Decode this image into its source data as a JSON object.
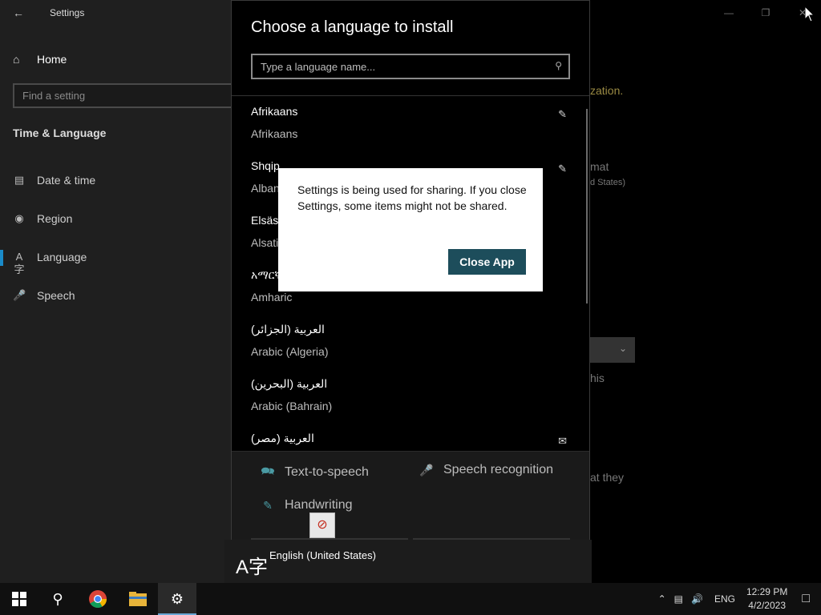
{
  "settings": {
    "app_title": "Settings",
    "home_label": "Home",
    "find_placeholder": "Find a setting",
    "section_title": "Time & Language",
    "nav": [
      {
        "label": "Date & time",
        "icon": "calendar-clock-icon"
      },
      {
        "label": "Region",
        "icon": "globe-icon"
      },
      {
        "label": "Language",
        "icon": "language-icon"
      },
      {
        "label": "Speech",
        "icon": "microphone-icon"
      }
    ],
    "accent_color": "#1a8bc9"
  },
  "background_snippets": {
    "s1": "zation.",
    "s2": "mat",
    "s3": "d States)",
    "s4": "his",
    "s5": "at they"
  },
  "dialog": {
    "title": "Choose a language to install",
    "search_placeholder": "Type a language name...",
    "languages": [
      {
        "native": "Afrikaans",
        "english": "Afrikaans",
        "feature_icon": "handwriting-icon"
      },
      {
        "native": "Shqip",
        "english": "Alban",
        "feature_icon": "handwriting-icon"
      },
      {
        "native": "Elsäss",
        "english": "Alsati"
      },
      {
        "native": "አማርኛ",
        "english": "Amharic"
      },
      {
        "native": "العربية (الجزائر)",
        "english": "Arabic (Algeria)"
      },
      {
        "native": "العربية (البحرين)",
        "english": "Arabic (Bahrain)"
      },
      {
        "native": "العربية (مصر)",
        "english": "",
        "feature_icon": "display-language-icon"
      }
    ],
    "features": {
      "tts": "Text-to-speech",
      "speech": "Speech recognition",
      "handwriting": "Handwriting"
    }
  },
  "alert": {
    "message": "Settings is being used for sharing. If you close Settings, some items might not be shared.",
    "button": "Close App",
    "button_color": "#1d4d5b"
  },
  "flyout": {
    "language": "English (United States)"
  },
  "taskbar": {
    "ime": "ENG",
    "time": "12:29 PM",
    "date": "4/2/2023"
  }
}
